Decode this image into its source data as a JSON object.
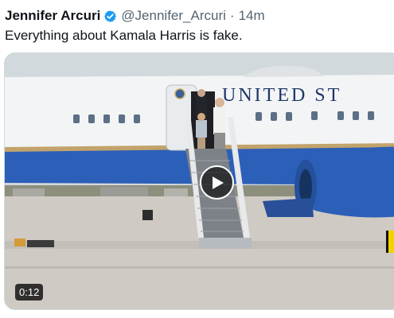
{
  "tweet": {
    "author_name": "Jennifer Arcuri",
    "handle": "@Jennifer_Arcuri",
    "separator": "·",
    "timestamp": "14m",
    "text": "Everything about Kamala Harris is fake.",
    "verified_icon": "verified-badge-icon",
    "colors": {
      "verified": "#1d9bf0",
      "secondary_text": "#536471",
      "primary_text": "#0f1419"
    }
  },
  "media": {
    "aircraft_lettering": "UNITED ST",
    "duration": "0:12",
    "play_icon": "play-icon"
  }
}
